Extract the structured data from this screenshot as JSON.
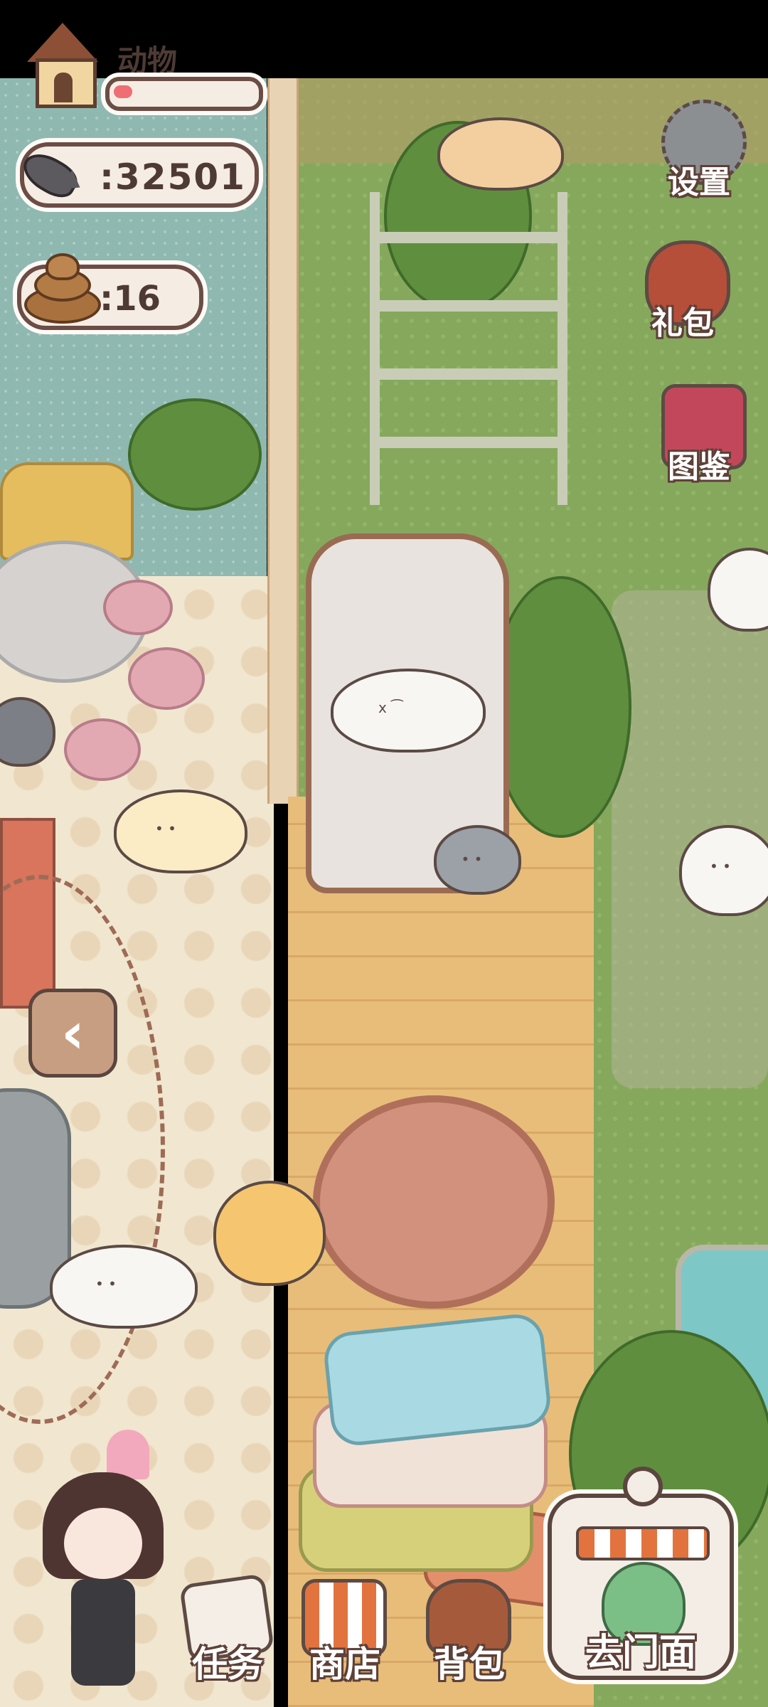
{
  "hud": {
    "animal_label": "动物",
    "animal_progress": 0.13,
    "fish_value": ":32501",
    "poop_value": ":16"
  },
  "side_buttons": {
    "settings": "设置",
    "gift": "礼包",
    "guide": "图鉴"
  },
  "bottom_buttons": {
    "task": "任务",
    "shop": "商店",
    "bag": "背包",
    "storefront": "去门面"
  },
  "colors": {
    "progress_fill": "#ef6e73",
    "hud_border": "#6b4d45",
    "label_outline": "#5e4038"
  },
  "icons": {
    "house": "house-icon",
    "fish": "fish-icon",
    "poop": "poop-icon",
    "settings": "gear-icon",
    "gift": "gift-bag-icon",
    "guide": "book-icon",
    "back": "chevron-left-icon",
    "task": "paper-icon",
    "shop": "shop-icon",
    "bag": "backpack-icon",
    "storefront": "storefront-icon"
  }
}
